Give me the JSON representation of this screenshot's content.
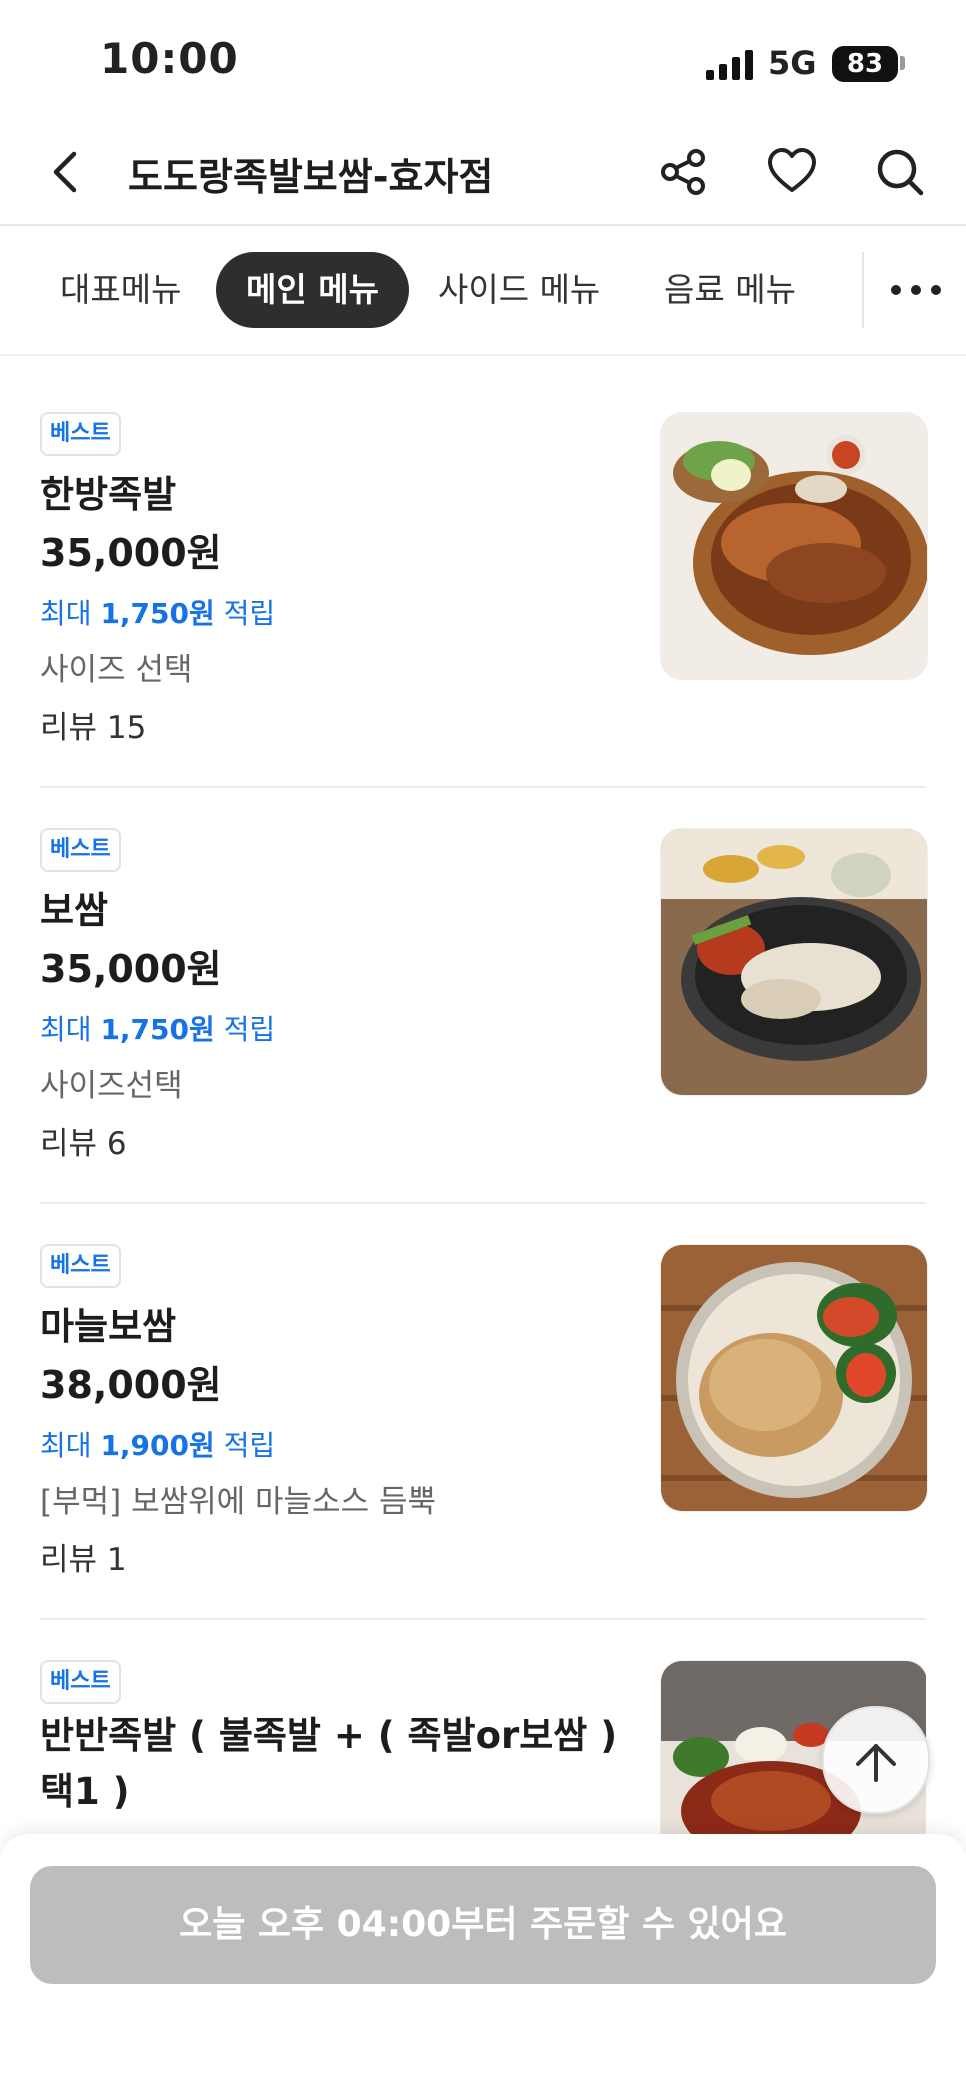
{
  "status_bar": {
    "time": "10:00",
    "network": "5G",
    "battery": "83"
  },
  "header": {
    "title": "도도랑족발보쌈-효자점"
  },
  "tabs": [
    {
      "label": "대표메뉴"
    },
    {
      "label": "메인 메뉴",
      "active": true
    },
    {
      "label": "사이드 메뉴"
    },
    {
      "label": "음료 메뉴"
    }
  ],
  "menu_items": [
    {
      "badge": "베스트",
      "name": "한방족발",
      "price": "35,000원",
      "reward_prefix": "최대",
      "reward_amount": "1,750원",
      "reward_suffix": "적립",
      "description": "사이즈 선택",
      "reviews": "리뷰 15"
    },
    {
      "badge": "베스트",
      "name": "보쌈",
      "price": "35,000원",
      "reward_prefix": "최대",
      "reward_amount": "1,750원",
      "reward_suffix": "적립",
      "description": "사이즈선택",
      "reviews": "리뷰 6"
    },
    {
      "badge": "베스트",
      "name": "마늘보쌈",
      "price": "38,000원",
      "reward_prefix": "최대",
      "reward_amount": "1,900원",
      "reward_suffix": "적립",
      "description": "[부먹] 보쌈위에 마늘소스 듬뿍",
      "reviews": "리뷰 1"
    },
    {
      "badge": "베스트",
      "name": "반반족발 ( 불족발 + ( 족발or보쌈 ) 택1 )"
    }
  ],
  "order_button": {
    "label": "오늘 오후 04:00부터 주문할 수 있어요"
  },
  "icons": {
    "back": "chevron-left-icon",
    "share": "share-icon",
    "favorite": "heart-icon",
    "search": "search-icon",
    "more": "more-horizontal-icon",
    "scroll_top": "arrow-up-icon"
  },
  "colors": {
    "accent_blue": "#1673e6",
    "active_tab": "#2e2e2e",
    "disabled_button": "#bdbdbd"
  }
}
